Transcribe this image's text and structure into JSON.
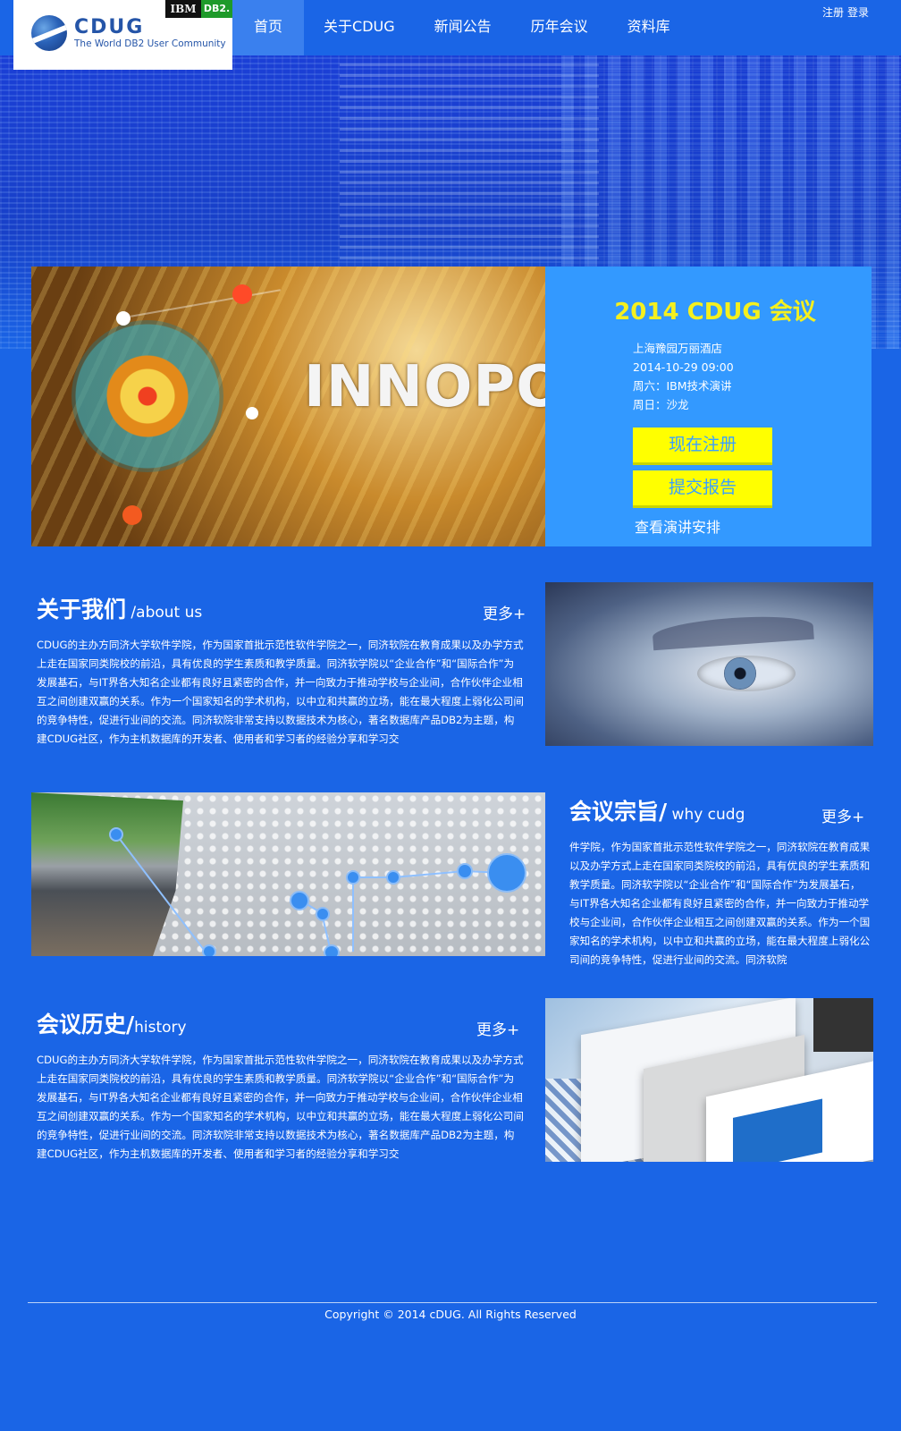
{
  "logo": {
    "text": "CDUG",
    "subtitle": "The World DB2 User Community",
    "ibm": "IBM",
    "db2": "DB2."
  },
  "nav": [
    {
      "label": "首页"
    },
    {
      "label": "关于CDUG"
    },
    {
      "label": "新闻公告"
    },
    {
      "label": "历年会议"
    },
    {
      "label": "资料库"
    }
  ],
  "auth": {
    "register": "注册",
    "login": "登录"
  },
  "hero": {
    "image_word": "INNOPO"
  },
  "event": {
    "title": "2014 CDUG 会议",
    "venue": "上海豫园万丽酒店",
    "datetime": "2014-10-29 09:00",
    "saturday": "周六：IBM技术演讲",
    "sunday": "周日：沙龙",
    "register_button": "现在注册",
    "report_button": "提交报告",
    "schedule_link": "查看演讲安排"
  },
  "about": {
    "title": "关于我们",
    "subtitle": " /about us",
    "more": "更多+",
    "text": "CDUG的主办方同济大学软件学院，作为国家首批示范性软件学院之一，同济软院在教育成果以及办学方式上走在国家同类院校的前沿，具有优良的学生素质和教学质量。同济软学院以“企业合作”和“国际合作”为发展基石，与IT界各大知名企业都有良好且紧密的合作，并一向致力于推动学校与企业间，合作伙伴企业相互之间创建双赢的关系。作为一个国家知名的学术机构，以中立和共赢的立场，能在最大程度上弱化公司间的竞争特性，促进行业间的交流。同济软院非常支持以数据技术为核心，著名数据库产品DB2为主题，构建CDUG社区，作为主机数据库的开发者、使用者和学习者的经验分享和学习交"
  },
  "why": {
    "title": "会议宗旨/",
    "subtitle": " why cudg",
    "more": "更多+",
    "text": "件学院，作为国家首批示范性软件学院之一，同济软院在教育成果以及办学方式上走在国家同类院校的前沿，具有优良的学生素质和教学质量。同济软学院以“企业合作”和“国际合作”为发展基石，与IT界各大知名企业都有良好且紧密的合作，并一向致力于推动学校与企业间，合作伙伴企业相互之间创建双赢的关系。作为一个国家知名的学术机构，以中立和共赢的立场，能在最大程度上弱化公司间的竞争特性，促进行业间的交流。同济软院"
  },
  "history": {
    "title": "会议历史/",
    "subtitle": "history",
    "more": "更多+",
    "text": "CDUG的主办方同济大学软件学院，作为国家首批示范性软件学院之一，同济软院在教育成果以及办学方式上走在国家同类院校的前沿，具有优良的学生素质和教学质量。同济软学院以“企业合作”和“国际合作”为发展基石，与IT界各大知名企业都有良好且紧密的合作，并一向致力于推动学校与企业间，合作伙伴企业相互之间创建双赢的关系。作为一个国家知名的学术机构，以中立和共赢的立场，能在最大程度上弱化公司间的竞争特性，促进行业间的交流。同济软院非常支持以数据技术为核心，著名数据库产品DB2为主题，构建CDUG社区，作为主机数据库的开发者、使用者和学习者的经验分享和学习交"
  },
  "footer": {
    "copyright": "Copyright © 2014 cDUG. All Rights Reserved"
  },
  "colors": {
    "page_bg": "#1a65e6",
    "event_panel": "#3399ff",
    "accent_yellow": "#ffff00",
    "title_yellow": "#f5f01e"
  }
}
